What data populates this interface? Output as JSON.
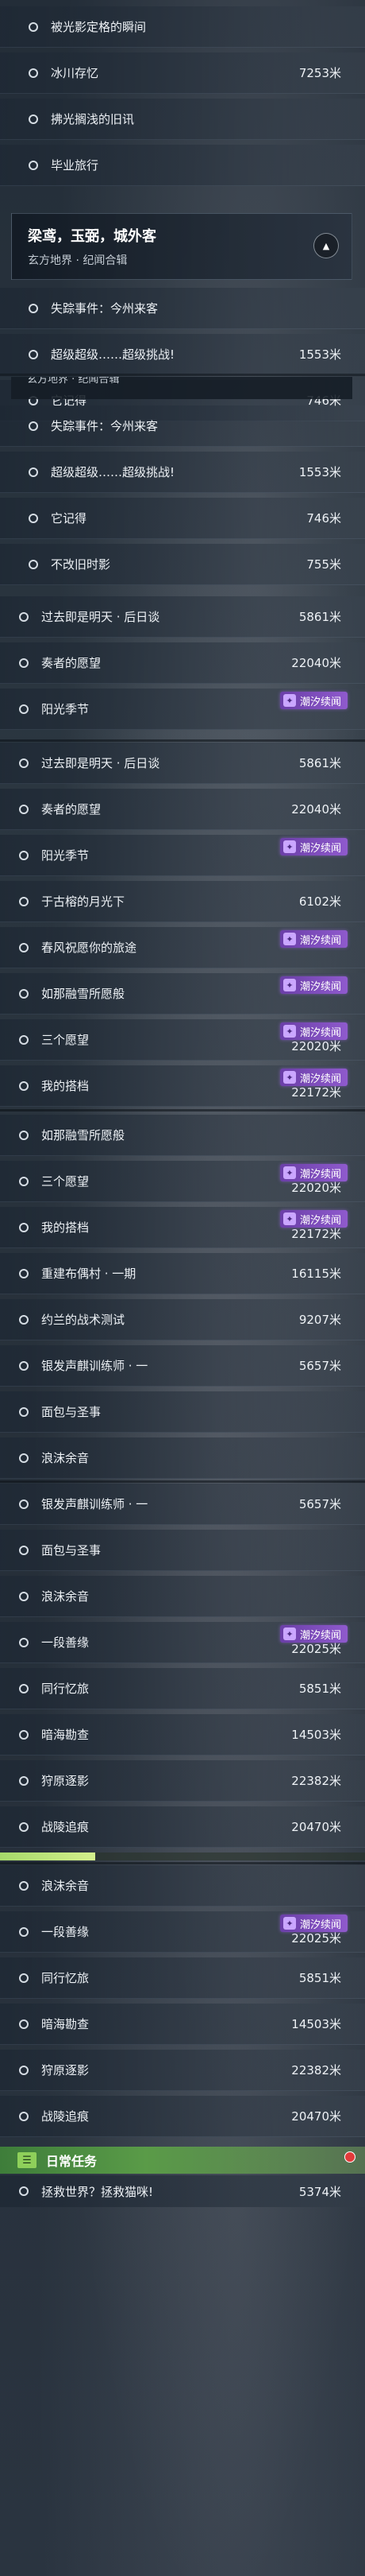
{
  "badge_text": "潮汐续闻",
  "segments": [
    {
      "top": 0,
      "rows": [
        {
          "label": "被光影定格的瞬间",
          "dist": "",
          "indent": true
        },
        {
          "label": "冰川存忆",
          "dist": "7253米",
          "indent": true
        },
        {
          "label": "拂光搁浅的旧讯",
          "dist": "",
          "indent": true
        },
        {
          "label": "毕业旅行",
          "dist": "",
          "indent": true
        }
      ]
    }
  ],
  "header": {
    "title": "梁鸢，玉弼，城外客",
    "subtitle": "玄方地界 · 纪闻合辑"
  },
  "header_cut_text": "玄方地界 · 纪闻合辑",
  "seg1": [
    {
      "label": "失踪事件：今州来客",
      "dist": ""
    },
    {
      "label": "超级超级……超级挑战!",
      "dist": "1553米"
    },
    {
      "label": "它记得",
      "dist": "746米"
    }
  ],
  "seg2": [
    {
      "label": "失踪事件：今州来客",
      "dist": ""
    },
    {
      "label": "超级超级……超级挑战!",
      "dist": "1553米"
    },
    {
      "label": "它记得",
      "dist": "746米"
    },
    {
      "label": "不改旧时影",
      "dist": "755米"
    }
  ],
  "seg2b": [
    {
      "label": "过去即是明天 · 后日谈",
      "dist": "5861米"
    },
    {
      "label": "奏者的愿望",
      "dist": "22040米"
    },
    {
      "label": "阳光季节",
      "dist": "",
      "badge": true
    }
  ],
  "seg3": [
    {
      "label": "过去即是明天 · 后日谈",
      "dist": "5861米"
    },
    {
      "label": "奏者的愿望",
      "dist": "22040米"
    },
    {
      "label": "阳光季节",
      "dist": "",
      "badge": true
    },
    {
      "label": "于古榕的月光下",
      "dist": "6102米"
    },
    {
      "label": "春风祝愿你的旅途",
      "dist": "",
      "badge": true
    },
    {
      "label": "如那融雪所愿般",
      "dist": "",
      "badge": true
    },
    {
      "label": "三个愿望",
      "dist": "22020米",
      "badge": true
    },
    {
      "label": "我的搭档",
      "dist": "22172米",
      "badge": true
    }
  ],
  "seg4": [
    {
      "label": "如那融雪所愿般",
      "dist": ""
    },
    {
      "label": "三个愿望",
      "dist": "22020米",
      "badge": true
    },
    {
      "label": "我的搭档",
      "dist": "22172米",
      "badge": true
    },
    {
      "label": "重建布偶村 · 一期",
      "dist": "16115米"
    },
    {
      "label": "约兰的战术测试",
      "dist": "9207米"
    },
    {
      "label": "银发声麒训练师 · 一",
      "dist": "5657米"
    },
    {
      "label": "面包与圣事",
      "dist": ""
    },
    {
      "label": "浪沫余音",
      "dist": ""
    }
  ],
  "seg5": [
    {
      "label": "银发声麒训练师 · 一",
      "dist": "5657米"
    },
    {
      "label": "面包与圣事",
      "dist": ""
    },
    {
      "label": "浪沫余音",
      "dist": ""
    },
    {
      "label": "一段善缘",
      "dist": "22025米",
      "badge": true
    },
    {
      "label": "同行忆旅",
      "dist": "5851米"
    },
    {
      "label": "暗海勘查",
      "dist": "14503米"
    },
    {
      "label": "狩原逐影",
      "dist": "22382米"
    },
    {
      "label": "战陵追痕",
      "dist": "20470米"
    }
  ],
  "seg6": [
    {
      "label": "浪沫余音",
      "dist": ""
    },
    {
      "label": "一段善缘",
      "dist": "22025米",
      "badge": true
    },
    {
      "label": "同行忆旅",
      "dist": "5851米"
    },
    {
      "label": "暗海勘查",
      "dist": "14503米"
    },
    {
      "label": "狩原逐影",
      "dist": "22382米"
    },
    {
      "label": "战陵追痕",
      "dist": "20470米"
    }
  ],
  "daily": {
    "label": "日常任务",
    "task_label": "拯救世界？拯救猫咪!",
    "task_dist": "5374米"
  },
  "colors": {
    "badge": "#8f5acd",
    "daily_green": "#5a9b48",
    "alert": "#e23b3b"
  }
}
